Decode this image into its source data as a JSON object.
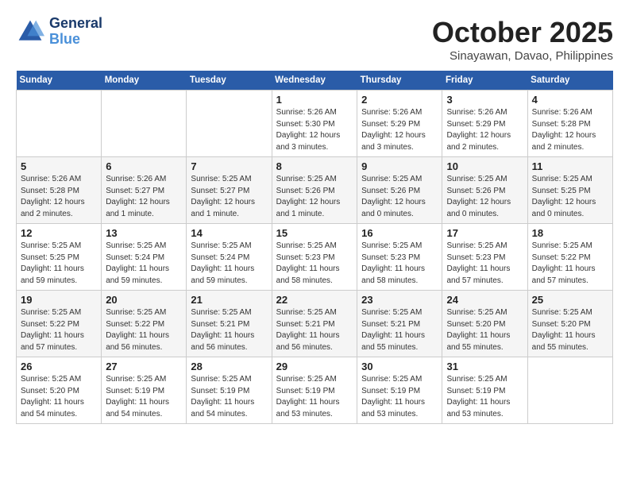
{
  "logo": {
    "line1": "General",
    "line2": "Blue"
  },
  "title": "October 2025",
  "location": "Sinayawan, Davao, Philippines",
  "days_of_week": [
    "Sunday",
    "Monday",
    "Tuesday",
    "Wednesday",
    "Thursday",
    "Friday",
    "Saturday"
  ],
  "weeks": [
    [
      {
        "day": "",
        "info": ""
      },
      {
        "day": "",
        "info": ""
      },
      {
        "day": "",
        "info": ""
      },
      {
        "day": "1",
        "info": "Sunrise: 5:26 AM\nSunset: 5:30 PM\nDaylight: 12 hours\nand 3 minutes."
      },
      {
        "day": "2",
        "info": "Sunrise: 5:26 AM\nSunset: 5:29 PM\nDaylight: 12 hours\nand 3 minutes."
      },
      {
        "day": "3",
        "info": "Sunrise: 5:26 AM\nSunset: 5:29 PM\nDaylight: 12 hours\nand 2 minutes."
      },
      {
        "day": "4",
        "info": "Sunrise: 5:26 AM\nSunset: 5:28 PM\nDaylight: 12 hours\nand 2 minutes."
      }
    ],
    [
      {
        "day": "5",
        "info": "Sunrise: 5:26 AM\nSunset: 5:28 PM\nDaylight: 12 hours\nand 2 minutes."
      },
      {
        "day": "6",
        "info": "Sunrise: 5:26 AM\nSunset: 5:27 PM\nDaylight: 12 hours\nand 1 minute."
      },
      {
        "day": "7",
        "info": "Sunrise: 5:25 AM\nSunset: 5:27 PM\nDaylight: 12 hours\nand 1 minute."
      },
      {
        "day": "8",
        "info": "Sunrise: 5:25 AM\nSunset: 5:26 PM\nDaylight: 12 hours\nand 1 minute."
      },
      {
        "day": "9",
        "info": "Sunrise: 5:25 AM\nSunset: 5:26 PM\nDaylight: 12 hours\nand 0 minutes."
      },
      {
        "day": "10",
        "info": "Sunrise: 5:25 AM\nSunset: 5:26 PM\nDaylight: 12 hours\nand 0 minutes."
      },
      {
        "day": "11",
        "info": "Sunrise: 5:25 AM\nSunset: 5:25 PM\nDaylight: 12 hours\nand 0 minutes."
      }
    ],
    [
      {
        "day": "12",
        "info": "Sunrise: 5:25 AM\nSunset: 5:25 PM\nDaylight: 11 hours\nand 59 minutes."
      },
      {
        "day": "13",
        "info": "Sunrise: 5:25 AM\nSunset: 5:24 PM\nDaylight: 11 hours\nand 59 minutes."
      },
      {
        "day": "14",
        "info": "Sunrise: 5:25 AM\nSunset: 5:24 PM\nDaylight: 11 hours\nand 59 minutes."
      },
      {
        "day": "15",
        "info": "Sunrise: 5:25 AM\nSunset: 5:23 PM\nDaylight: 11 hours\nand 58 minutes."
      },
      {
        "day": "16",
        "info": "Sunrise: 5:25 AM\nSunset: 5:23 PM\nDaylight: 11 hours\nand 58 minutes."
      },
      {
        "day": "17",
        "info": "Sunrise: 5:25 AM\nSunset: 5:23 PM\nDaylight: 11 hours\nand 57 minutes."
      },
      {
        "day": "18",
        "info": "Sunrise: 5:25 AM\nSunset: 5:22 PM\nDaylight: 11 hours\nand 57 minutes."
      }
    ],
    [
      {
        "day": "19",
        "info": "Sunrise: 5:25 AM\nSunset: 5:22 PM\nDaylight: 11 hours\nand 57 minutes."
      },
      {
        "day": "20",
        "info": "Sunrise: 5:25 AM\nSunset: 5:22 PM\nDaylight: 11 hours\nand 56 minutes."
      },
      {
        "day": "21",
        "info": "Sunrise: 5:25 AM\nSunset: 5:21 PM\nDaylight: 11 hours\nand 56 minutes."
      },
      {
        "day": "22",
        "info": "Sunrise: 5:25 AM\nSunset: 5:21 PM\nDaylight: 11 hours\nand 56 minutes."
      },
      {
        "day": "23",
        "info": "Sunrise: 5:25 AM\nSunset: 5:21 PM\nDaylight: 11 hours\nand 55 minutes."
      },
      {
        "day": "24",
        "info": "Sunrise: 5:25 AM\nSunset: 5:20 PM\nDaylight: 11 hours\nand 55 minutes."
      },
      {
        "day": "25",
        "info": "Sunrise: 5:25 AM\nSunset: 5:20 PM\nDaylight: 11 hours\nand 55 minutes."
      }
    ],
    [
      {
        "day": "26",
        "info": "Sunrise: 5:25 AM\nSunset: 5:20 PM\nDaylight: 11 hours\nand 54 minutes."
      },
      {
        "day": "27",
        "info": "Sunrise: 5:25 AM\nSunset: 5:19 PM\nDaylight: 11 hours\nand 54 minutes."
      },
      {
        "day": "28",
        "info": "Sunrise: 5:25 AM\nSunset: 5:19 PM\nDaylight: 11 hours\nand 54 minutes."
      },
      {
        "day": "29",
        "info": "Sunrise: 5:25 AM\nSunset: 5:19 PM\nDaylight: 11 hours\nand 53 minutes."
      },
      {
        "day": "30",
        "info": "Sunrise: 5:25 AM\nSunset: 5:19 PM\nDaylight: 11 hours\nand 53 minutes."
      },
      {
        "day": "31",
        "info": "Sunrise: 5:25 AM\nSunset: 5:19 PM\nDaylight: 11 hours\nand 53 minutes."
      },
      {
        "day": "",
        "info": ""
      }
    ]
  ]
}
